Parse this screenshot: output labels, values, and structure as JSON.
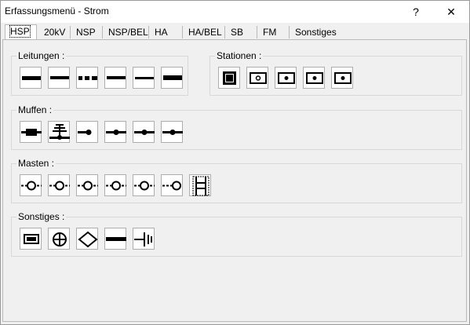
{
  "window": {
    "title": "Erfassungsmenü - Strom",
    "help_label": "?",
    "close_label": "✕"
  },
  "tabs": [
    "HSP",
    "20kV",
    "NSP",
    "NSP/BEL",
    "HA",
    "HA/BEL",
    "SB",
    "FM",
    "Sonstiges"
  ],
  "groups": {
    "leitungen": {
      "label": "Leitungen :"
    },
    "stationen": {
      "label": "Stationen :"
    },
    "muffen": {
      "label": "Muffen :"
    },
    "masten": {
      "label": "Masten :"
    },
    "sonstiges": {
      "label": "Sonstiges :"
    }
  },
  "icons": {
    "leitungen": [
      "line-thick-icon",
      "line-medium-icon",
      "line-dashed-icon",
      "line-medium-icon",
      "line-thin-icon",
      "line-bold-icon"
    ],
    "stationen": [
      "station-filled-square-icon",
      "station-circle-icon",
      "station-dot-icon",
      "station-dot-icon",
      "station-dot-icon"
    ],
    "muffen": [
      "muff-rectangle-icon",
      "muff-ground-icon",
      "muff-end-icon",
      "muff-junction-icon",
      "muff-junction-icon",
      "muff-junction-icon"
    ],
    "masten": [
      "mast-circle-icon",
      "mast-circle-icon",
      "mast-circle-icon",
      "mast-circle-icon",
      "mast-circle-icon",
      "mast-end-circle-icon",
      "mast-frame-icon"
    ],
    "sonstiges": [
      "battery-icon",
      "circle-plus-icon",
      "diamond-icon",
      "bar-icon",
      "earth-terminal-icon"
    ]
  }
}
